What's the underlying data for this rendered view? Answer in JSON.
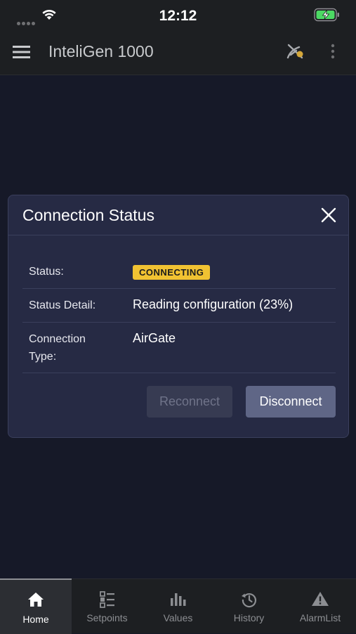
{
  "status_bar": {
    "time": "12:12"
  },
  "app_bar": {
    "title": "InteliGen 1000"
  },
  "dialog": {
    "title": "Connection Status",
    "rows": [
      {
        "label": "Status:",
        "value": "CONNECTING"
      },
      {
        "label": "Status Detail:",
        "value": "Reading configuration (23%)"
      },
      {
        "label": "Connection Type:",
        "value": "AirGate"
      }
    ],
    "buttons": {
      "reconnect": "Reconnect",
      "disconnect": "Disconnect"
    }
  },
  "colors": {
    "badge": "#f1c232",
    "background": "#161928",
    "dialog": "#262a44",
    "battery": "#4cd964"
  },
  "bottom_nav": {
    "items": [
      {
        "label": "Home",
        "icon": "home-icon",
        "active": true
      },
      {
        "label": "Setpoints",
        "icon": "setpoints-icon"
      },
      {
        "label": "Values",
        "icon": "values-icon"
      },
      {
        "label": "History",
        "icon": "history-icon"
      },
      {
        "label": "AlarmList",
        "icon": "alarm-icon"
      }
    ]
  }
}
